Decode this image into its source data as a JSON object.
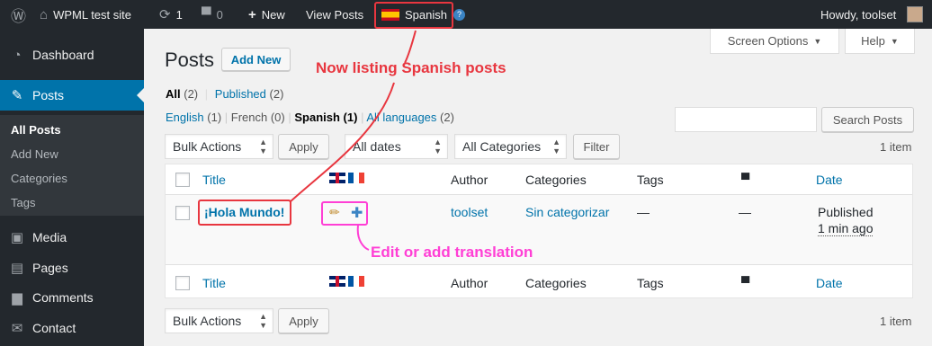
{
  "adminbar": {
    "site_name": "WPML test site",
    "updates_count": "1",
    "comments_count": "0",
    "new_label": "New",
    "view_posts": "View Posts",
    "language": "Spanish",
    "howdy": "Howdy, toolset"
  },
  "sidebar": {
    "items": [
      {
        "label": "Dashboard",
        "icon": "dashboard-icon"
      },
      {
        "label": "Posts",
        "icon": "pin-icon"
      },
      {
        "label": "Media",
        "icon": "media-icon"
      },
      {
        "label": "Pages",
        "icon": "pages-icon"
      },
      {
        "label": "Comments",
        "icon": "comment-icon"
      },
      {
        "label": "Contact",
        "icon": "mail-icon"
      }
    ],
    "submenu": [
      "All Posts",
      "Add New",
      "Categories",
      "Tags"
    ]
  },
  "screen_options": "Screen Options",
  "help": "Help",
  "page": {
    "title": "Posts",
    "add_new": "Add New"
  },
  "status_filter": {
    "all": "All",
    "all_count": "(2)",
    "published": "Published",
    "published_count": "(2)",
    "sep": "|"
  },
  "lang_filter": {
    "english": "English",
    "english_count": "(1)",
    "french": "French (0)",
    "spanish": "Spanish (1)",
    "all_languages": "All languages",
    "all_languages_count": "(2)"
  },
  "search": {
    "button": "Search Posts",
    "value": ""
  },
  "top_nav": {
    "bulk_actions": "Bulk Actions",
    "apply": "Apply",
    "dates": "All dates",
    "categories": "All Categories",
    "filter": "Filter",
    "count": "1 item"
  },
  "bottom_nav": {
    "bulk_actions": "Bulk Actions",
    "apply": "Apply",
    "count": "1 item"
  },
  "table": {
    "headers": {
      "title": "Title",
      "author": "Author",
      "categories": "Categories",
      "tags": "Tags",
      "date": "Date"
    },
    "row": {
      "title": "¡Hola Mundo!",
      "author": "toolset",
      "categories": "Sin categorizar",
      "tags": "—",
      "comments": "—",
      "status": "Published",
      "time": "1 min ago"
    }
  },
  "annotations": {
    "spanish_note": "Now listing Spanish posts",
    "translation_note": "Edit or add translation",
    "red": "#e8363f",
    "pink": "#ff3fd5"
  },
  "icons": {
    "edit": "pencil-icon",
    "add": "plus-icon"
  }
}
